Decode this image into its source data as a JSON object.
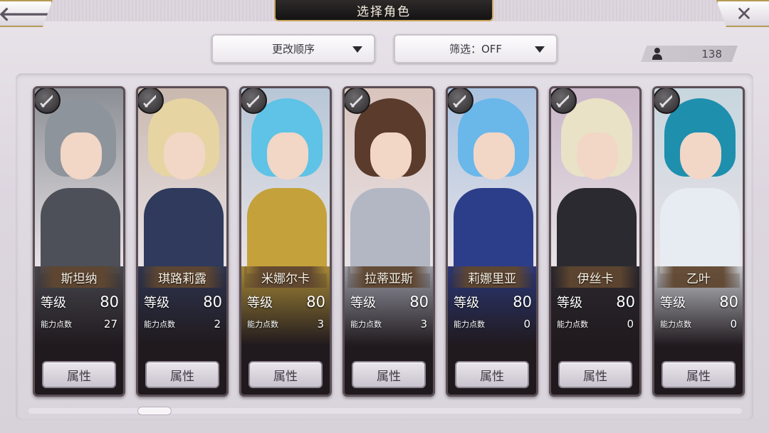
{
  "header": {
    "title": "选择角色",
    "back_icon": "arrow-left-icon",
    "close_icon": "close-icon"
  },
  "controls": {
    "sort_label": "更改顺序",
    "filter_label": "筛选：OFF",
    "character_count": "138"
  },
  "cards": [
    {
      "name": "斯坦纳",
      "level_label": "等级",
      "level": "80",
      "ap_label": "能力点数",
      "ap": "27",
      "button": "属性",
      "hair": "#8e949c",
      "body": "#4d5058",
      "bg": "#8b8f95"
    },
    {
      "name": "琪路莉露",
      "level_label": "等级",
      "level": "80",
      "ap_label": "能力点数",
      "ap": "2",
      "button": "属性",
      "hair": "#e6d5a2",
      "body": "#2f3a5c",
      "bg": "#c9b8ae"
    },
    {
      "name": "米娜尔卡",
      "level_label": "等级",
      "level": "80",
      "ap_label": "能力点数",
      "ap": "3",
      "button": "属性",
      "hair": "#5ec3e6",
      "body": "#c4a13a",
      "bg": "#b7c6d6"
    },
    {
      "name": "拉蒂亚斯",
      "level_label": "等级",
      "level": "80",
      "ap_label": "能力点数",
      "ap": "3",
      "button": "属性",
      "hair": "#5a3b2c",
      "body": "#b3b7c4",
      "bg": "#d9c4bd"
    },
    {
      "name": "莉娜里亚",
      "level_label": "等级",
      "level": "80",
      "ap_label": "能力点数",
      "ap": "0",
      "button": "属性",
      "hair": "#6ab7ea",
      "body": "#2c3d8a",
      "bg": "#a9c2e0"
    },
    {
      "name": "伊丝卡",
      "level_label": "等级",
      "level": "80",
      "ap_label": "能力点数",
      "ap": "0",
      "button": "属性",
      "hair": "#e9e2c6",
      "body": "#2b2a30",
      "bg": "#c9b6c8"
    },
    {
      "name": "乙叶",
      "level_label": "等级",
      "level": "80",
      "ap_label": "能力点数",
      "ap": "0",
      "button": "属性",
      "hair": "#1f8fae",
      "body": "#e7ecf2",
      "bg": "#c7d6de"
    }
  ]
}
